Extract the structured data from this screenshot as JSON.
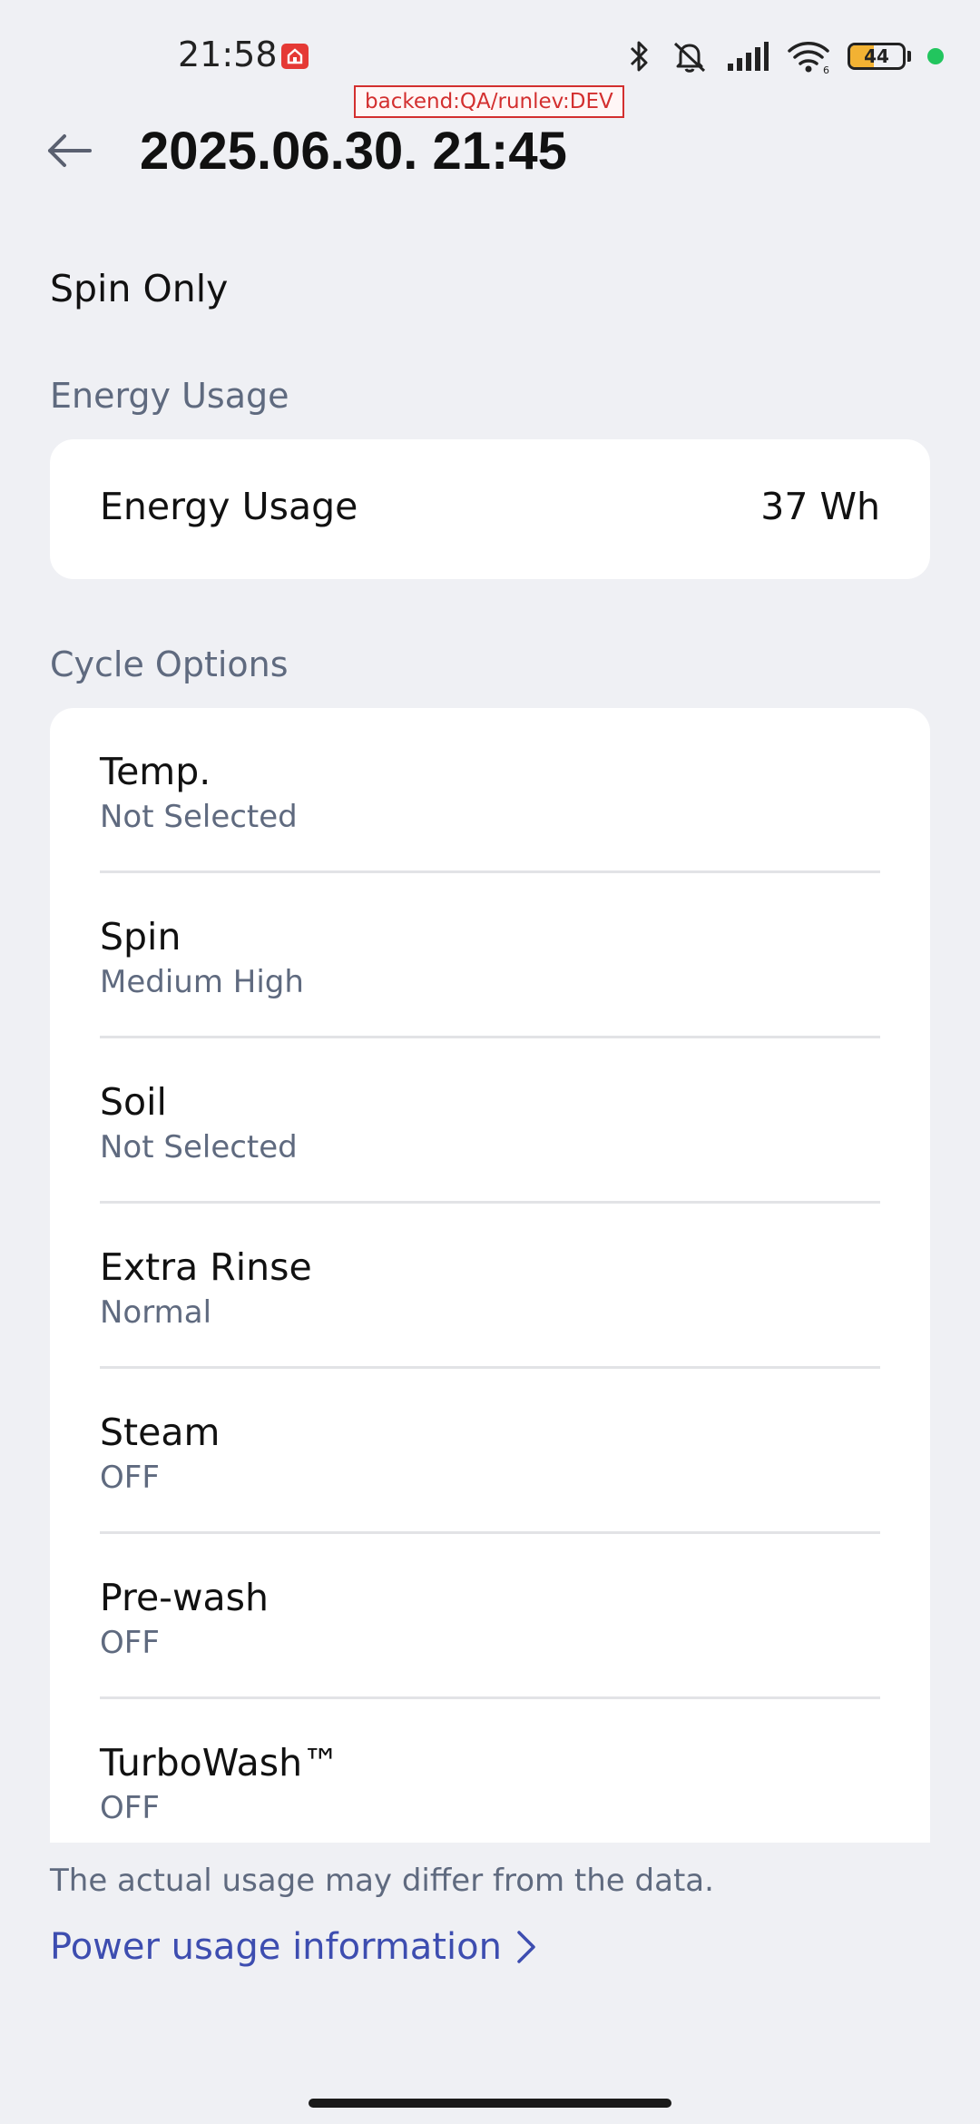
{
  "status_bar": {
    "time": "21:58",
    "battery_level": "44",
    "battery_fraction": 0.44
  },
  "dev_badge": "backend:QA/runlev:DEV",
  "header": {
    "title": "2025.06.30. 21:45"
  },
  "course": {
    "name": "Spin Only"
  },
  "energy": {
    "section_title": "Energy Usage",
    "label": "Energy Usage",
    "value": "37 Wh"
  },
  "cycle_options": {
    "section_title": "Cycle Options",
    "items": [
      {
        "name": "Temp.",
        "value": "Not Selected"
      },
      {
        "name": "Spin",
        "value": "Medium High"
      },
      {
        "name": "Soil",
        "value": "Not Selected"
      },
      {
        "name": "Extra Rinse",
        "value": "Normal"
      },
      {
        "name": "Steam",
        "value": "OFF"
      },
      {
        "name": "Pre-wash",
        "value": "OFF"
      },
      {
        "name": "TurboWash™",
        "value": "OFF"
      }
    ]
  },
  "footer": {
    "disclaimer": "The actual usage may differ from the data.",
    "power_link": "Power usage information"
  },
  "colors": {
    "background": "#eff0f4",
    "card": "#ffffff",
    "secondary_text": "#5f6a7f",
    "link": "#3d4db0",
    "badge": "#d32f2f",
    "battery": "#f2b233",
    "status_dot": "#22c55e"
  },
  "icons": {
    "back": "arrow-left-icon",
    "link_chevron": "chevron-right-icon",
    "bluetooth": "bluetooth-icon",
    "mute": "muted-bell-icon",
    "signal": "cellular-signal-icon",
    "wifi": "wifi-icon",
    "battery": "battery-icon",
    "app": "home-app-icon"
  }
}
